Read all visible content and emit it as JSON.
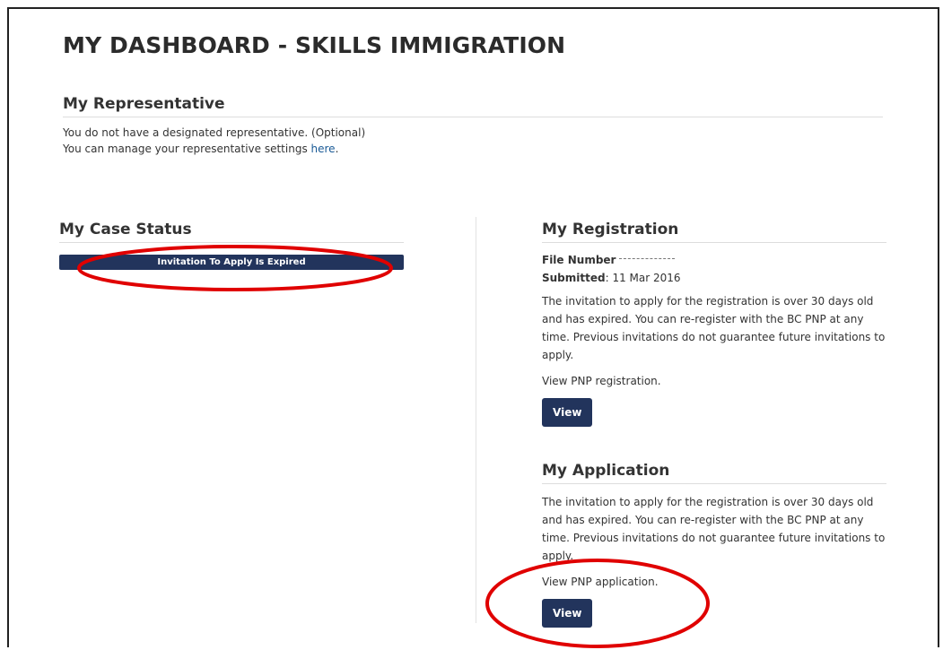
{
  "page": {
    "title": "MY DASHBOARD - SKILLS IMMIGRATION"
  },
  "representative": {
    "heading": "My Representative",
    "line1": "You do not have a designated representative. (Optional)",
    "line2_prefix": "You can manage your representative settings ",
    "line2_link": "here",
    "line2_suffix": "."
  },
  "case_status": {
    "heading": "My Case Status",
    "status_label": "Invitation To Apply Is Expired"
  },
  "registration": {
    "heading": "My Registration",
    "file_number_label": "File Number",
    "submitted_label": "Submitted",
    "submitted_value": ": 11 Mar 2016",
    "message": "The invitation to apply for the registration is over 30 days old and has expired. You can re-register with the BC PNP at any time. Previous invitations do not guarantee future invitations to apply.",
    "view_text": "View PNP registration.",
    "view_button": "View"
  },
  "application": {
    "heading": "My Application",
    "message": "The invitation to apply for the registration is over 30 days old and has expired. You can re-register with the BC PNP at any time. Previous invitations do not guarantee future invitations to apply.",
    "view_text": "View PNP application.",
    "view_button": "View"
  },
  "colors": {
    "primary": "#22345c",
    "link": "#1a5a96",
    "annotation": "#e00000"
  }
}
